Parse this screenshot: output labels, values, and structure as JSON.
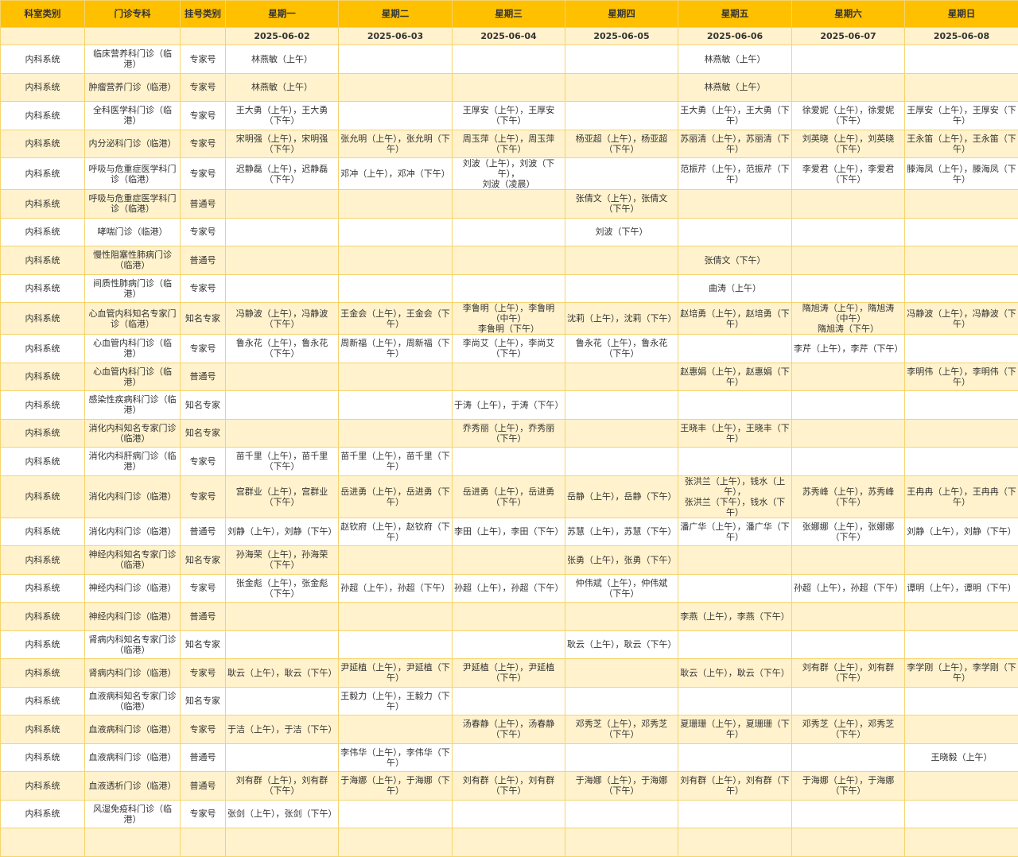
{
  "headers": [
    "科室类别",
    "门诊专科",
    "挂号类别",
    "星期一",
    "星期二",
    "星期三",
    "星期四",
    "星期五",
    "星期六",
    "星期日"
  ],
  "dates": [
    "",
    "",
    "",
    "2025-06-02",
    "2025-06-03",
    "2025-06-04",
    "2025-06-05",
    "2025-06-06",
    "2025-06-07",
    "2025-06-08"
  ],
  "rows": [
    [
      "内科系统",
      "临床营养科门诊（临港）",
      "专家号",
      "林燕敏（上午）",
      "",
      "",
      "",
      "林燕敏（上午）",
      "",
      ""
    ],
    [
      "内科系统",
      "肿瘤营养门诊（临港）",
      "专家号",
      "林燕敏（上午）",
      "",
      "",
      "",
      "林燕敏（上午）",
      "",
      ""
    ],
    [
      "内科系统",
      "全科医学科门诊（临港）",
      "专家号",
      "王大勇（上午），王大勇（下午）",
      "",
      "王厚安（上午），王厚安（下午）",
      "",
      "王大勇（上午），王大勇（下午）",
      "徐爱妮（上午），徐爱妮（下午）",
      "王厚安（上午），王厚安（下午）"
    ],
    [
      "内科系统",
      "内分泌科门诊（临港）",
      "专家号",
      "宋明强（上午），宋明强（下午）",
      "张允明（上午），张允明（下午）",
      "周玉萍（上午），周玉萍（下午）",
      "杨亚超（上午），杨亚超（下午）",
      "苏丽清（上午），苏丽清（下午）",
      "刘英晓（上午），刘英晓（下午）",
      "王永笛（上午），王永笛（下午）"
    ],
    [
      "内科系统",
      "呼吸与危重症医学科门诊（临港）",
      "专家号",
      "迟静磊（上午），迟静磊（下午）",
      "邓冲（上午），邓冲（下午）",
      "刘波（上午），刘波（下午），\n刘波（凌晨）",
      "",
      "范振芹（上午），范振芹（下午）",
      "李爱君（上午），李爱君（下午）",
      "滕海凤（上午），滕海凤（下午）"
    ],
    [
      "内科系统",
      "呼吸与危重症医学科门诊（临港）",
      "普通号",
      "",
      "",
      "",
      "张倩文（上午），张倩文（下午）",
      "",
      "",
      ""
    ],
    [
      "内科系统",
      "哮喘门诊（临港）",
      "专家号",
      "",
      "",
      "",
      "刘波（下午）",
      "",
      "",
      ""
    ],
    [
      "内科系统",
      "慢性阻塞性肺病门诊（临港）",
      "普通号",
      "",
      "",
      "",
      "",
      "张倩文（下午）",
      "",
      ""
    ],
    [
      "内科系统",
      "间质性肺病门诊（临港）",
      "专家号",
      "",
      "",
      "",
      "",
      "曲涛（上午）",
      "",
      ""
    ],
    [
      "内科系统",
      "心血管内科知名专家门诊（临港）",
      "知名专家",
      "冯静波（上午），冯静波（下午）",
      "王金会（上午），王金会（下午）",
      "李鲁明（上午），李鲁明（中午）\n李鲁明（下午）",
      "沈莉（上午），沈莉（下午）",
      "赵培勇（上午），赵培勇（下午）",
      "隋旭涛（上午），隋旭涛（中午）\n隋旭涛（下午）",
      "冯静波（上午），冯静波（下午）"
    ],
    [
      "内科系统",
      "心血管内科门诊（临港）",
      "专家号",
      "鲁永花（上午），鲁永花（下午）",
      "周新福（上午），周新福（下午）",
      "李尚艾（上午），李尚艾（下午）",
      "鲁永花（上午），鲁永花（下午）",
      "",
      "李芹（上午），李芹（下午）",
      ""
    ],
    [
      "内科系统",
      "心血管内科门诊（临港）",
      "普通号",
      "",
      "",
      "",
      "",
      "赵惠娟（上午），赵惠娟（下午）",
      "",
      "李明伟（上午），李明伟（下午）"
    ],
    [
      "内科系统",
      "感染性疾病科门诊（临港）",
      "知名专家",
      "",
      "",
      "于涛（上午），于涛（下午）",
      "",
      "",
      "",
      ""
    ],
    [
      "内科系统",
      "消化内科知名专家门诊（临港）",
      "知名专家",
      "",
      "",
      "乔秀丽（上午），乔秀丽（下午）",
      "",
      "王晓丰（上午），王晓丰（下午）",
      "",
      ""
    ],
    [
      "内科系统",
      "消化内科肝病门诊（临港）",
      "专家号",
      "苗千里（上午），苗千里（下午）",
      "苗千里（上午），苗千里（下午）",
      "",
      "",
      "",
      "",
      ""
    ],
    [
      "内科系统",
      "消化内科门诊（临港）",
      "专家号",
      "宫群业（上午），宫群业（下午）",
      "岳进勇（上午），岳进勇（下午）",
      "岳进勇（上午），岳进勇（下午）",
      "岳静（上午），岳静（下午）",
      "张洪兰（上午），钱水（上午），\n张洪兰（下午），钱水（下午）",
      "苏秀峰（上午），苏秀峰（下午）",
      "王冉冉（上午），王冉冉（下午）"
    ],
    [
      "内科系统",
      "消化内科门诊（临港）",
      "普通号",
      "刘静（上午），刘静（下午）",
      "赵钦府（上午），赵钦府（下午）",
      "李田（上午），李田（下午）",
      "苏慧（上午），苏慧（下午）",
      "潘广华（上午），潘广华（下午）",
      "张娜娜（上午），张娜娜（下午）",
      "刘静（上午），刘静（下午）"
    ],
    [
      "内科系统",
      "神经内科知名专家门诊（临港）",
      "知名专家",
      "孙海荣（上午），孙海荣（下午）",
      "",
      "",
      "张勇（上午），张勇（下午）",
      "",
      "",
      ""
    ],
    [
      "内科系统",
      "神经内科门诊（临港）",
      "专家号",
      "张金彪（上午），张金彪（下午）",
      "孙超（上午），孙超（下午）",
      "孙超（上午），孙超（下午）",
      "仲伟斌（上午），仲伟斌（下午）",
      "",
      "孙超（上午），孙超（下午）",
      "谭明（上午），谭明（下午）"
    ],
    [
      "内科系统",
      "神经内科门诊（临港）",
      "普通号",
      "",
      "",
      "",
      "",
      "李燕（上午），李燕（下午）",
      "",
      ""
    ],
    [
      "内科系统",
      "肾病内科知名专家门诊（临港）",
      "知名专家",
      "",
      "",
      "",
      "耿云（上午），耿云（下午）",
      "",
      "",
      ""
    ],
    [
      "内科系统",
      "肾病内科门诊（临港）",
      "专家号",
      "耿云（上午），耿云（下午）",
      "尹延植（上午），尹延植（下午）",
      "尹延植（上午），尹延植（下午）",
      "",
      "耿云（上午），耿云（下午）",
      "刘有群（上午），刘有群（下午）",
      "李学刚（上午），李学刚（下午）"
    ],
    [
      "内科系统",
      "血液病科知名专家门诊（临港）",
      "知名专家",
      "",
      "王毅力（上午），王毅力（下午）",
      "",
      "",
      "",
      "",
      ""
    ],
    [
      "内科系统",
      "血液病科门诊（临港）",
      "专家号",
      "于洁（上午），于洁（下午）",
      "",
      "汤春静（上午），汤春静（下午）",
      "邓秀芝（上午），邓秀芝（下午）",
      "夏珊珊（上午），夏珊珊（下午）",
      "邓秀芝（上午），邓秀芝（下午）",
      ""
    ],
    [
      "内科系统",
      "血液病科门诊（临港）",
      "普通号",
      "",
      "李伟华（上午），李伟华（下午）",
      "",
      "",
      "",
      "",
      "王晓毅（上午）"
    ],
    [
      "内科系统",
      "血液透析门诊（临港）",
      "普通号",
      "刘有群（上午），刘有群（下午）",
      "于海娜（上午），于海娜（下午）",
      "刘有群（上午），刘有群（下午）",
      "于海娜（上午），于海娜（下午）",
      "刘有群（上午），刘有群（下午）",
      "于海娜（上午），于海娜（下午）",
      ""
    ],
    [
      "内科系统",
      "风湿免疫科门诊（临港）",
      "专家号",
      "张剑（上午），张剑（下午）",
      "",
      "",
      "",
      "",
      "",
      ""
    ],
    [
      "",
      "",
      "",
      "",
      "",
      "",
      "",
      "",
      "",
      ""
    ]
  ]
}
